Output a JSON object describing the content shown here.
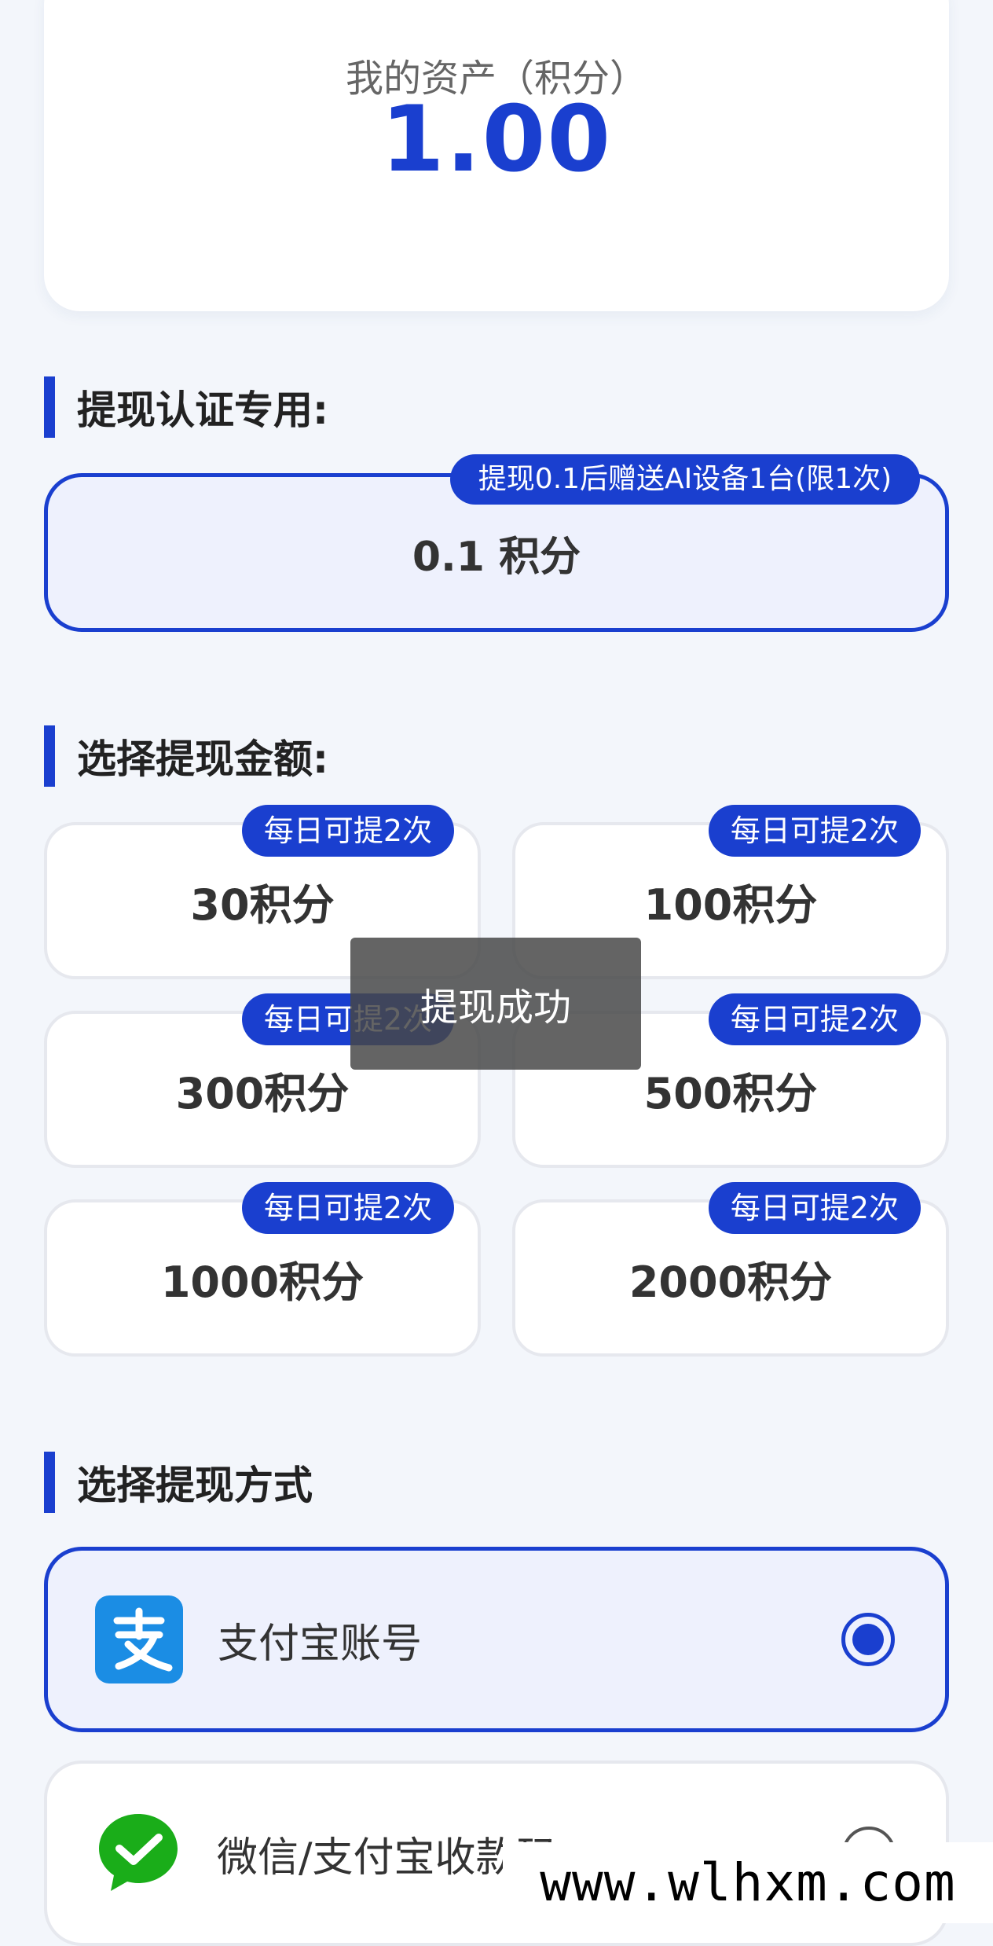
{
  "assets": {
    "label": "我的资产（积分）",
    "value": "1.00"
  },
  "cert_section": {
    "title": "提现认证专用:",
    "option_label": "0.1 积分",
    "badge": "提现0.1后赠送AI设备1台(限1次)"
  },
  "amount_section": {
    "title": "选择提现金额:",
    "options": [
      {
        "label": "30积分",
        "badge": "每日可提2次"
      },
      {
        "label": "100积分",
        "badge": "每日可提2次"
      },
      {
        "label": "300积分",
        "badge": "每日可提2次"
      },
      {
        "label": "500积分",
        "badge": "每日可提2次"
      },
      {
        "label": "1000积分",
        "badge": "每日可提2次"
      },
      {
        "label": "2000积分",
        "badge": "每日可提2次"
      }
    ]
  },
  "toast": {
    "message": "提现成功"
  },
  "method_section": {
    "title": "选择提现方式",
    "options": [
      {
        "label": "支付宝账号",
        "icon": "alipay-icon",
        "selected": true
      },
      {
        "label": "微信/支付宝收款码",
        "icon": "wechat-pay-icon",
        "selected": false
      }
    ]
  },
  "watermark": {
    "text": "www.wlhxm.com"
  },
  "colors": {
    "accent": "#1a3fcf",
    "background": "#f3f6fb",
    "alipay": "#1b8de4",
    "wechat": "#1aad19"
  }
}
